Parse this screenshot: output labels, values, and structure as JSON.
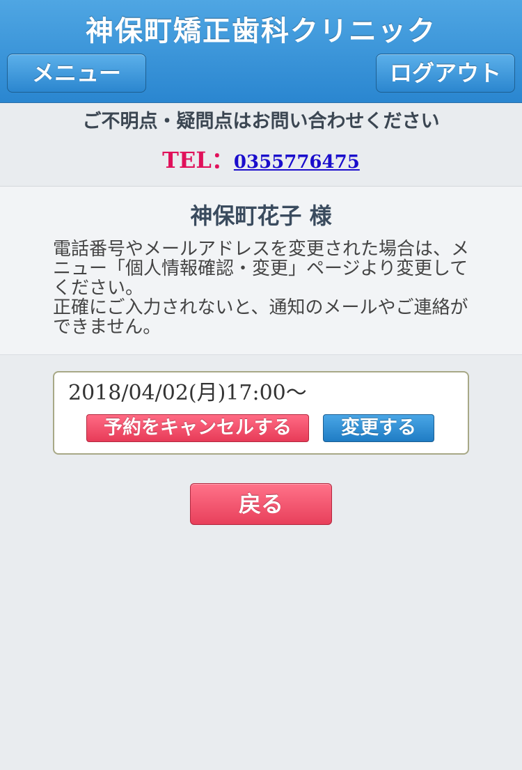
{
  "header": {
    "title": "神保町矯正歯科クリニック",
    "menu_label": "メニュー",
    "logout_label": "ログアウト"
  },
  "contact": {
    "note": "ご不明点・疑問点はお問い合わせください",
    "tel_label": "TEL：",
    "tel_number": "0355776475"
  },
  "user": {
    "name": "神保町花子 様",
    "notice": "電話番号やメールアドレスを変更された場合は、メニュー「個人情報確認・変更」ページより変更してください。\n正確にご入力されないと、通知のメールやご連絡ができません。"
  },
  "reservation": {
    "datetime": "2018/04/02(月)17:00〜",
    "cancel_label": "予約をキャンセルする",
    "change_label": "変更する"
  },
  "back_label": "戻る",
  "colors": {
    "header_blue": "#2a86d0",
    "tel_red": "#e0115a",
    "link_blue": "#1a0dcc",
    "cancel_red": "#e73b58",
    "change_blue": "#1f7cc4"
  }
}
